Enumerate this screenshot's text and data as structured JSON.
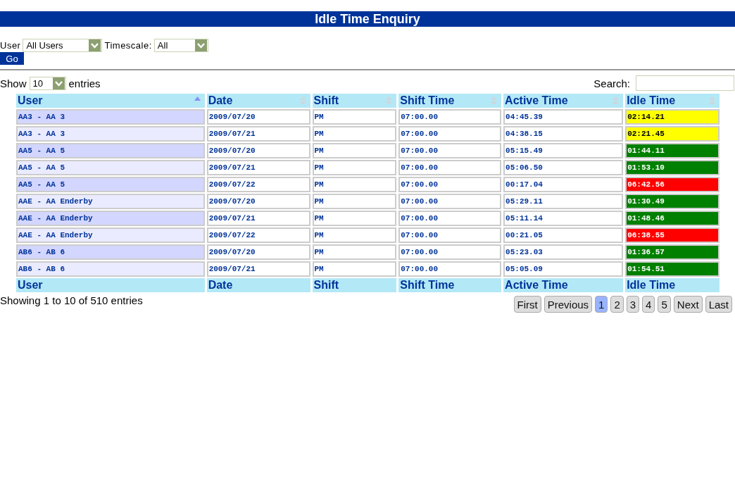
{
  "title": "Idle Time Enquiry",
  "filters": {
    "user_label": "User",
    "user_value": "All Users",
    "timescale_label": "Timescale:",
    "timescale_value": "All",
    "go": "Go"
  },
  "length": {
    "show": "Show",
    "value": "10",
    "entries": "entries"
  },
  "search": {
    "label": "Search:"
  },
  "table": {
    "columns": [
      {
        "label": "User",
        "sorted": true
      },
      {
        "label": "Date",
        "sorted": false
      },
      {
        "label": "Shift",
        "sorted": false
      },
      {
        "label": "Shift Time",
        "sorted": false
      },
      {
        "label": "Active Time",
        "sorted": false
      },
      {
        "label": "Idle Time",
        "sorted": false
      }
    ],
    "rows": [
      {
        "user": "AA3 - AA 3",
        "date": "2009/07/20",
        "shift": "PM",
        "shift_time": "07:00.00",
        "active_time": "04:45.39",
        "idle_time": "02:14.21",
        "color": "#ffff00"
      },
      {
        "user": "AA3 - AA 3",
        "date": "2009/07/21",
        "shift": "PM",
        "shift_time": "07:00.00",
        "active_time": "04:38.15",
        "idle_time": "02:21.45",
        "color": "#ffff00"
      },
      {
        "user": "AA5 - AA 5",
        "date": "2009/07/20",
        "shift": "PM",
        "shift_time": "07:00.00",
        "active_time": "05:15.49",
        "idle_time": "01:44.11",
        "color": "#008000"
      },
      {
        "user": "AA5 - AA 5",
        "date": "2009/07/21",
        "shift": "PM",
        "shift_time": "07:00.00",
        "active_time": "05:06.50",
        "idle_time": "01:53.10",
        "color": "#008000"
      },
      {
        "user": "AA5 - AA 5",
        "date": "2009/07/22",
        "shift": "PM",
        "shift_time": "07:00.00",
        "active_time": "00:17.04",
        "idle_time": "06:42.56",
        "color": "#ff0000"
      },
      {
        "user": "AAE - AA Enderby",
        "date": "2009/07/20",
        "shift": "PM",
        "shift_time": "07:00.00",
        "active_time": "05:29.11",
        "idle_time": "01:30.49",
        "color": "#008000"
      },
      {
        "user": "AAE - AA Enderby",
        "date": "2009/07/21",
        "shift": "PM",
        "shift_time": "07:00.00",
        "active_time": "05:11.14",
        "idle_time": "01:48.46",
        "color": "#008000"
      },
      {
        "user": "AAE - AA Enderby",
        "date": "2009/07/22",
        "shift": "PM",
        "shift_time": "07:00.00",
        "active_time": "00:21.05",
        "idle_time": "06:38.55",
        "color": "#ff0000"
      },
      {
        "user": "AB6 - AB 6",
        "date": "2009/07/20",
        "shift": "PM",
        "shift_time": "07:00.00",
        "active_time": "05:23.03",
        "idle_time": "01:36.57",
        "color": "#008000"
      },
      {
        "user": "AB6 - AB 6",
        "date": "2009/07/21",
        "shift": "PM",
        "shift_time": "07:00.00",
        "active_time": "05:05.09",
        "idle_time": "01:54.51",
        "color": "#008000"
      }
    ],
    "footer": [
      "User",
      "Date",
      "Shift",
      "Shift Time",
      "Active Time",
      "Idle Time"
    ]
  },
  "info": "Showing 1 to 10 of 510 entries",
  "pagination": [
    {
      "label": "First",
      "selected": false
    },
    {
      "label": "Previous",
      "selected": false
    },
    {
      "label": "1",
      "selected": true
    },
    {
      "label": "2",
      "selected": false
    },
    {
      "label": "3",
      "selected": false
    },
    {
      "label": "4",
      "selected": false
    },
    {
      "label": "5",
      "selected": false
    },
    {
      "label": "Next",
      "selected": false
    },
    {
      "label": "Last",
      "selected": false
    }
  ]
}
